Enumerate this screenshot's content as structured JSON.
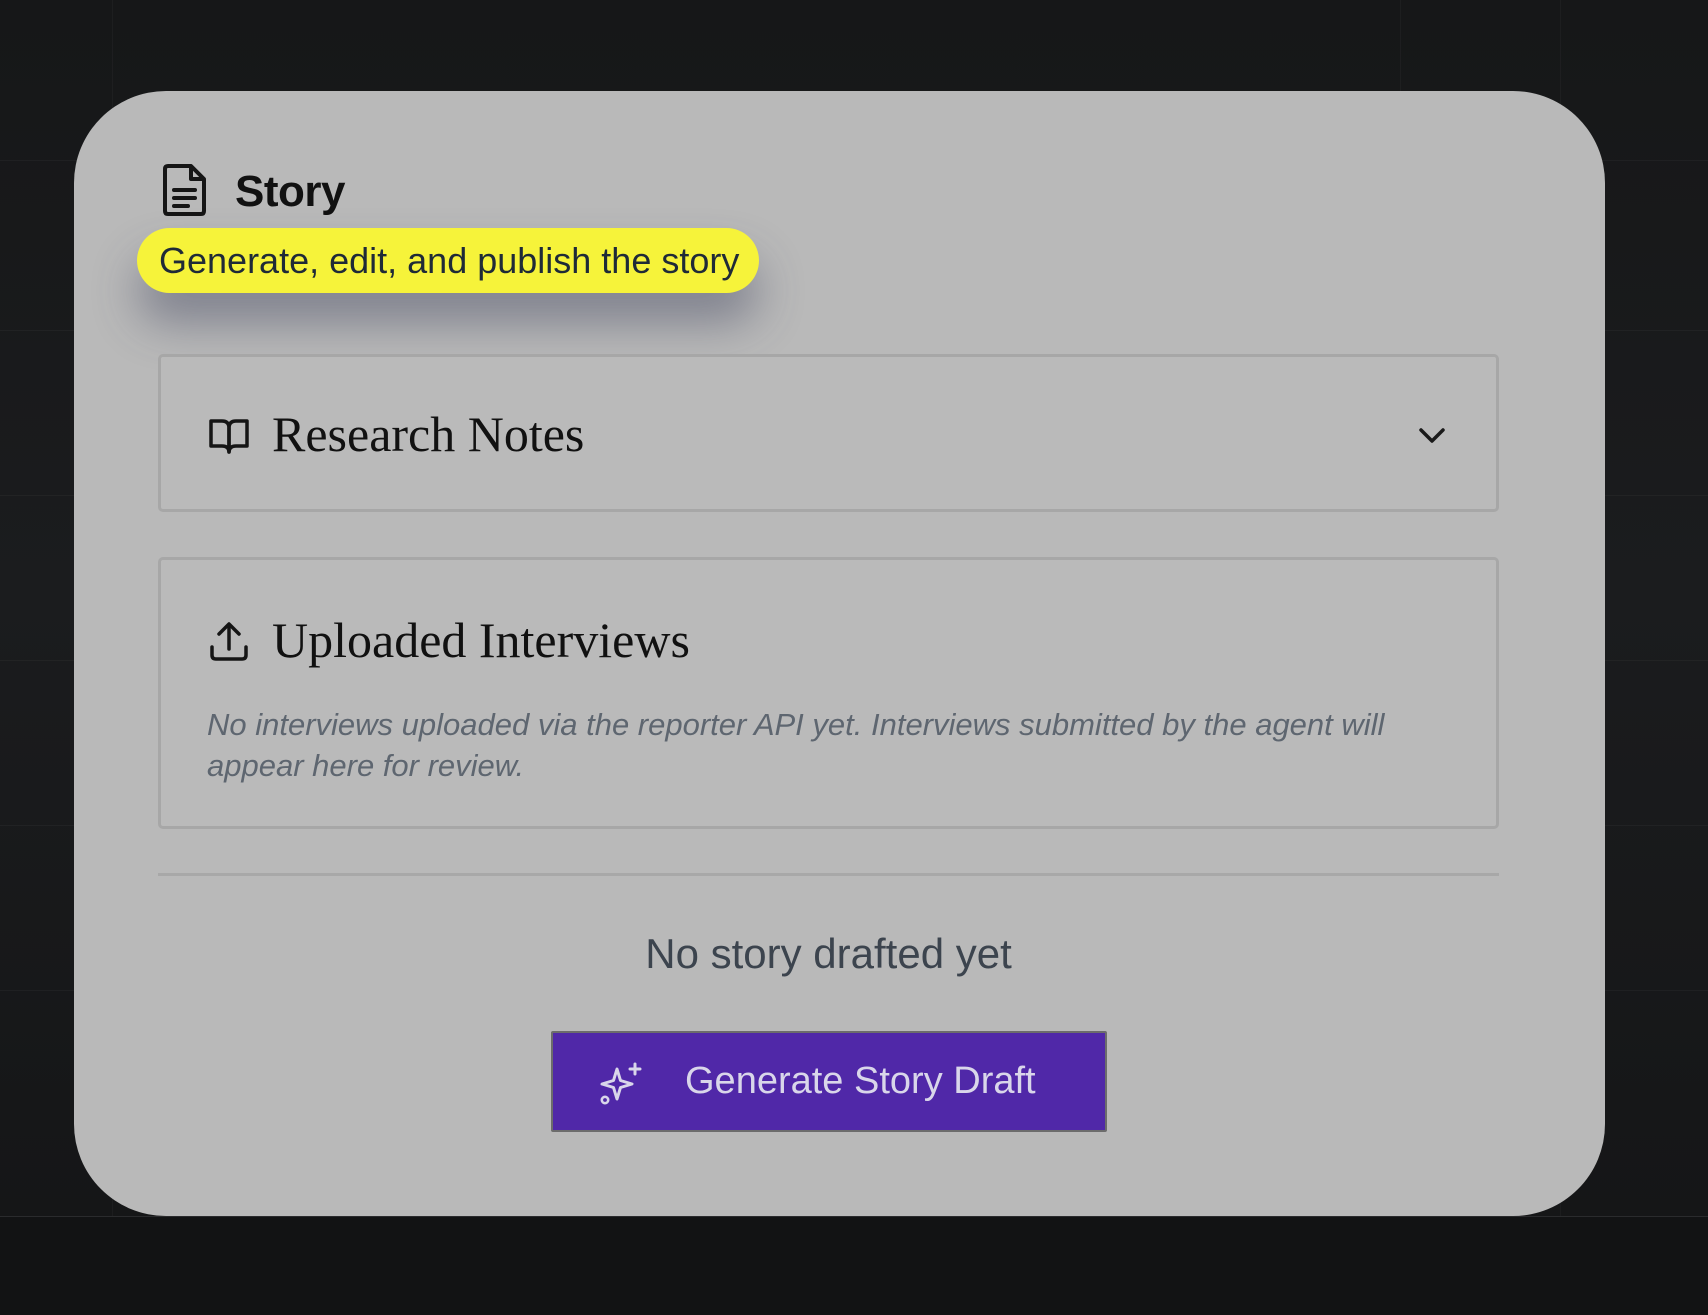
{
  "card": {
    "title": "Story",
    "title_icon": "document-icon",
    "subtitle": "Generate, edit, and publish the story",
    "highlight_color": "#f6f33a"
  },
  "research_notes": {
    "title": "Research Notes",
    "icon": "open-book-icon",
    "toggle_icon": "chevron-down-icon",
    "expanded": false
  },
  "uploaded_interviews": {
    "title": "Uploaded Interviews",
    "icon": "upload-icon",
    "empty_message": "No interviews uploaded via the reporter API yet. Interviews submitted by the agent will appear here for review."
  },
  "story_draft": {
    "empty_message": "No story drafted yet",
    "generate_button_label": "Generate Story Draft",
    "generate_button_icon": "sparkles-icon",
    "button_color": "#5028a8"
  }
}
